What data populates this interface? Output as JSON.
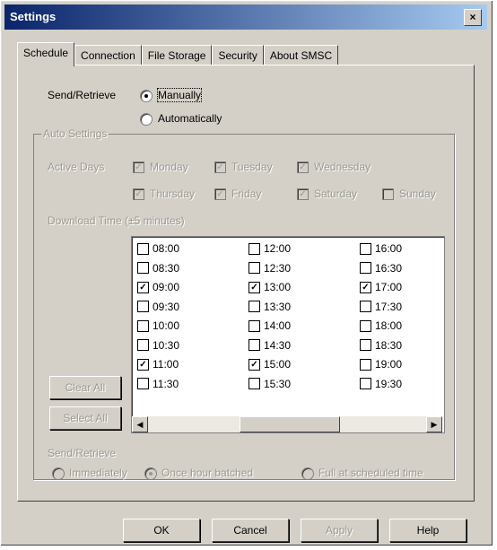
{
  "window": {
    "title": "Settings",
    "close_glyph": "×"
  },
  "tabs": [
    {
      "label": "Schedule",
      "active": true
    },
    {
      "label": "Connection",
      "active": false
    },
    {
      "label": "File Storage",
      "active": false
    },
    {
      "label": "Security",
      "active": false
    },
    {
      "label": "About SMSC",
      "active": false
    }
  ],
  "send_retrieve": {
    "label": "Send/Retrieve",
    "options": [
      {
        "label": "Manually",
        "selected": true
      },
      {
        "label": "Automatically",
        "selected": false
      }
    ]
  },
  "auto_settings": {
    "group_label": "Auto Settings",
    "active_days_label": "Active Days",
    "days": [
      {
        "label": "Monday",
        "checked": true
      },
      {
        "label": "Tuesday",
        "checked": true
      },
      {
        "label": "Wednesday",
        "checked": true
      },
      {
        "label": "Thursday",
        "checked": true
      },
      {
        "label": "Friday",
        "checked": true
      },
      {
        "label": "Saturday",
        "checked": true
      },
      {
        "label": "Sunday",
        "checked": false
      }
    ],
    "download_time_label": "Download Time (±5 minutes)",
    "times": [
      {
        "label": "08:00",
        "checked": false
      },
      {
        "label": "12:00",
        "checked": false
      },
      {
        "label": "16:00",
        "checked": false
      },
      {
        "label": "08:30",
        "checked": false
      },
      {
        "label": "12:30",
        "checked": false
      },
      {
        "label": "16:30",
        "checked": false
      },
      {
        "label": "09:00",
        "checked": true
      },
      {
        "label": "13:00",
        "checked": true
      },
      {
        "label": "17:00",
        "checked": true
      },
      {
        "label": "09:30",
        "checked": false
      },
      {
        "label": "13:30",
        "checked": false
      },
      {
        "label": "17:30",
        "checked": false
      },
      {
        "label": "10:00",
        "checked": false
      },
      {
        "label": "14:00",
        "checked": false
      },
      {
        "label": "18:00",
        "checked": false
      },
      {
        "label": "10:30",
        "checked": false
      },
      {
        "label": "14:30",
        "checked": false
      },
      {
        "label": "18:30",
        "checked": false
      },
      {
        "label": "11:00",
        "checked": true
      },
      {
        "label": "15:00",
        "checked": true
      },
      {
        "label": "19:00",
        "checked": false
      },
      {
        "label": "11:30",
        "checked": false
      },
      {
        "label": "15:30",
        "checked": false
      },
      {
        "label": "19:30",
        "checked": false
      }
    ],
    "clear_all_label": "Clear All",
    "select_all_label": "Select All",
    "send_retrieve_label": "Send/Retrieve",
    "send_options": [
      {
        "label": "Immediately",
        "selected": false
      },
      {
        "label": "Once hour batched",
        "selected": true
      },
      {
        "label": "Full at scheduled time",
        "selected": false
      }
    ]
  },
  "scroll": {
    "left_glyph": "◀",
    "right_glyph": "▶"
  },
  "footer": {
    "ok": "OK",
    "cancel": "Cancel",
    "apply": "Apply",
    "help": "Help"
  }
}
